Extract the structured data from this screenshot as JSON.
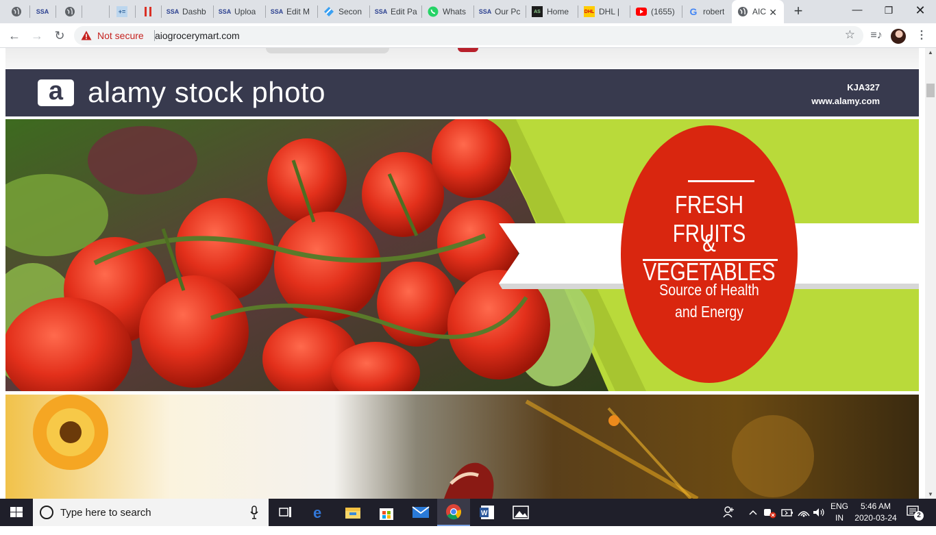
{
  "browser": {
    "tabs": [
      {
        "label": "",
        "icon": "globe-icon"
      },
      {
        "label": "",
        "icon": "ssa-icon"
      },
      {
        "label": "",
        "icon": "globe-icon"
      },
      {
        "label": "",
        "icon": "blank-icon"
      },
      {
        "label": "",
        "icon": "calculator-icon"
      },
      {
        "label": "",
        "icon": "pause-icon"
      },
      {
        "label": "Dashb",
        "icon": "ssa-icon"
      },
      {
        "label": "Uploa",
        "icon": "ssa-icon"
      },
      {
        "label": "Edit M",
        "icon": "ssa-icon"
      },
      {
        "label": "Secon",
        "icon": "diamond-icon"
      },
      {
        "label": "Edit Pa",
        "icon": "ssa-icon"
      },
      {
        "label": "Whats",
        "icon": "whatsapp-icon"
      },
      {
        "label": "Our Pc",
        "icon": "ssa-icon"
      },
      {
        "label": "Home",
        "icon": "home-app-icon"
      },
      {
        "label": "DHL |",
        "icon": "dhl-icon"
      },
      {
        "label": "(1655)",
        "icon": "youtube-icon"
      },
      {
        "label": "robert",
        "icon": "google-icon"
      },
      {
        "label": "AIC",
        "icon": "globe-icon",
        "active": true
      }
    ],
    "security_label": "Not secure",
    "url": "aiogrocerymart.com"
  },
  "page": {
    "watermark": {
      "logo_letter": "a",
      "brand": "alamy stock photo",
      "image_id": "KJA327",
      "site": "www.alamy.com"
    },
    "banner": {
      "headline_line1": "FRESH FRUITS",
      "headline_line2": "& VEGETABLES",
      "tagline_line1": "Source of Health",
      "tagline_line2": "and Energy",
      "colors": {
        "lime": "#b9da3a",
        "red": "#d9260f",
        "ribbon": "#ffffff",
        "tomato": "#e3301b"
      }
    }
  },
  "taskbar": {
    "search_placeholder": "Type here to search",
    "lang_line1": "ENG",
    "lang_line2": "IN",
    "time": "5:46 AM",
    "date": "2020-03-24",
    "notification_count": "2",
    "apps": [
      "task-view",
      "edge",
      "file-explorer",
      "store",
      "mail",
      "chrome",
      "word",
      "photos"
    ]
  }
}
